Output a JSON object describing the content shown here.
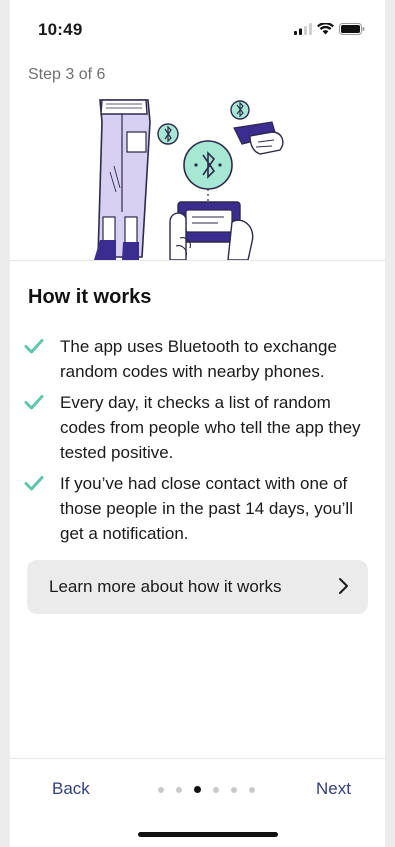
{
  "status_bar": {
    "time": "10:49",
    "icons": [
      "cellular-signal-icon",
      "wifi-icon",
      "battery-icon"
    ]
  },
  "progress": {
    "step_label": "Step 3 of 6",
    "current_step": 3,
    "total_steps": 6
  },
  "hero": {
    "illustration": "person-with-phone-bluetooth-illustration",
    "icons": [
      "bluetooth-icon",
      "bluetooth-icon",
      "bluetooth-icon"
    ]
  },
  "content": {
    "heading": "How it works",
    "bullets": [
      {
        "text": "The app uses Bluetooth to exchange random codes with nearby phones.",
        "icon": "checkmark-icon"
      },
      {
        "text": "Every day, it checks a list of random codes from people who tell the app they tested positive.",
        "icon": "checkmark-icon"
      },
      {
        "text": "If you’ve had close contact with one of those people in the past 14 days, you’ll get a notification.",
        "icon": "checkmark-icon"
      }
    ],
    "learn_more": {
      "label": "Learn more about how it works",
      "icon": "chevron-right-icon"
    }
  },
  "footer": {
    "back_label": "Back",
    "next_label": "Next",
    "page_dots": 6,
    "active_dot": 3
  },
  "colors": {
    "accent_green": "#5fc6ad",
    "nav_blue": "#33407a",
    "illustration_purple": "#3b2c8f",
    "illustration_lavender": "#d7d0f2",
    "bubble_mint": "#a6e8d4"
  }
}
